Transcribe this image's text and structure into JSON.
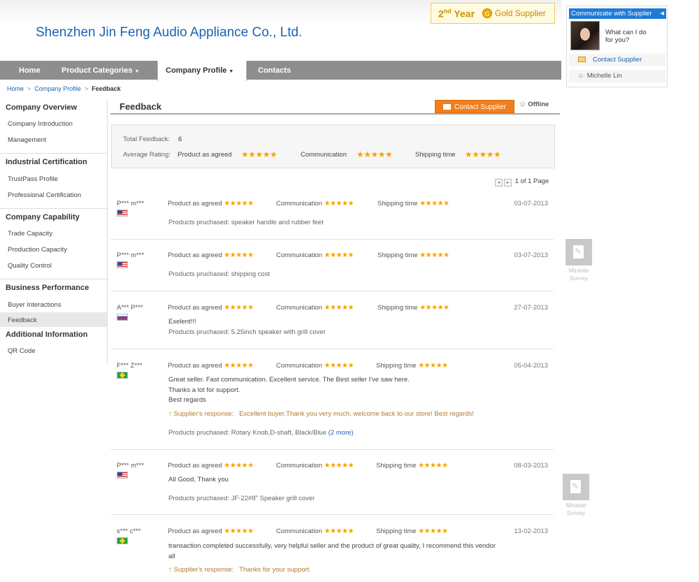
{
  "header": {
    "company_name": "Shenzhen Jin Feng Audio Appliance Co., Ltd.",
    "year_num": "2",
    "year_suffix": "nd",
    "year_word": " Year",
    "gold_icon": "gold-coin-icon",
    "gold_letter": "G",
    "gold_label": "Gold Supplier"
  },
  "nav": {
    "home": "Home",
    "product_categories": "Product Categories",
    "company_profile": "Company Profile",
    "contacts": "Contacts"
  },
  "breadcrumb": {
    "home": "Home",
    "company_profile": "Company Profile",
    "current": "Feedback",
    "sep": ">"
  },
  "sidebar": {
    "company_overview": "Company Overview",
    "company_introduction": "Company Introduction",
    "management": "Management",
    "industrial_certification": "Industrial Certification",
    "trustpass_profile": "TrustPass Profile",
    "professional_certification": "Professional Certification",
    "company_capability": "Company Capability",
    "trade_capacity": "Trade Capacity",
    "production_capacity": "Production Capacity",
    "quality_control": "Quality Control",
    "business_performance": "Business Performance",
    "buyer_interactions": "Buyer Interactions",
    "feedback": "Feedback",
    "additional_information": "Additional Information",
    "qr_code": "QR Code"
  },
  "main": {
    "title": "Feedback",
    "contact_supplier": "Contact Supplier",
    "offline": "Offline"
  },
  "summary": {
    "total_label": "Total Feedback:",
    "total_value": "6",
    "avg_label": "Average Rating:",
    "product_as_agreed": "Product as agreed",
    "communication": "Communication",
    "shipping_time": "Shipping time",
    "stars": "★★★★★"
  },
  "pager": {
    "prev": "◂",
    "next": "▸",
    "text": "1 of 1 Page"
  },
  "labels": {
    "product_as_agreed": "Product as agreed",
    "communication": "Communication",
    "shipping_time": "Shipping time",
    "stars": "★★★★★",
    "supplier_response": "Supplier's response:"
  },
  "reviews": [
    {
      "name": "P*** m***",
      "flag": "US",
      "date": "03-07-2013",
      "text": "",
      "response": "",
      "purchased": "Products pruchased: speaker handle and rubber feet"
    },
    {
      "name": "P*** m***",
      "flag": "US",
      "date": "03-07-2013",
      "text": "",
      "response": "",
      "purchased": "Products pruchased: shipping cost"
    },
    {
      "name": "A*** P***",
      "flag": "RU",
      "date": "27-07-2013",
      "text": "Exelent!!!",
      "response": "",
      "purchased": "Products pruchased: 5.25inch speaker with grill cover"
    },
    {
      "name": "F*** Z***",
      "flag": "BR",
      "date": "05-04-2013",
      "text_lines": [
        "Great seller. Fast communication. Excellent service. The Best seller I've saw here.",
        "Thanks a lot for support.",
        "Best regards"
      ],
      "response": "Excellent buyer,Thank you very much, welcome back to our store! Best regards!",
      "purchased": "Products pruchased: Rotary Knob,D-shaft, Black/Blue",
      "more": "(2 more)"
    },
    {
      "name": "P*** m***",
      "flag": "US",
      "date": "08-03-2013",
      "text": "All Good, Thank you",
      "response": "",
      "purchased": "Products pruchased: JF-22#8\" Speaker grill cover"
    },
    {
      "name": "s*** c***",
      "flag": "BR",
      "date": "13-02-2013",
      "text_lines": [
        "transaction completed successfully, very helpful seller and the product of great quality, I recommend this vendor",
        "all"
      ],
      "response": "Thanks for your support.",
      "purchased": ""
    }
  ],
  "right_panel": {
    "header": "Communicate with Supplier",
    "ask_line1": "What can I do",
    "ask_line2": "for you?",
    "contact": "Contact Supplier",
    "person": "Michelle Lin",
    "survey1": "Minisite",
    "survey2": "Survey"
  }
}
